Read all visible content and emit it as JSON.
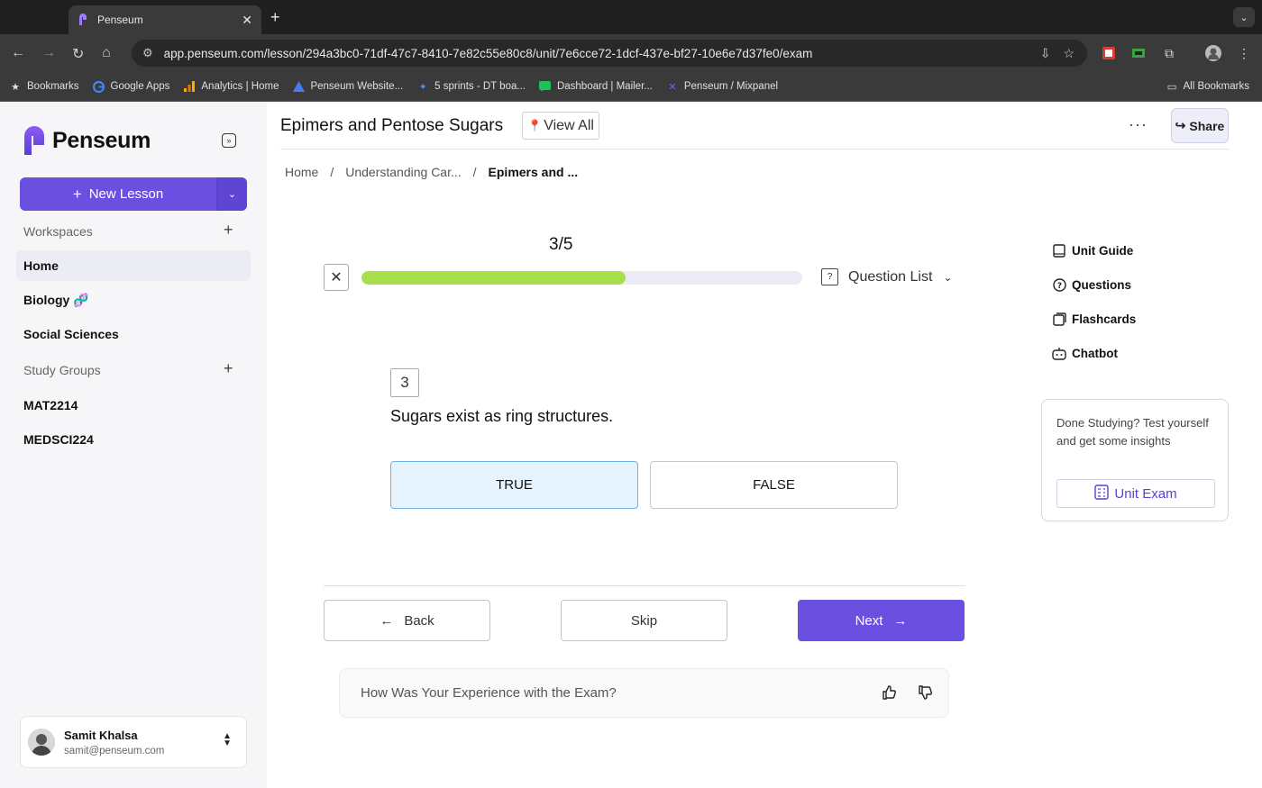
{
  "browser": {
    "tab_title": "Penseum",
    "url": "app.penseum.com/lesson/294a3bc0-71df-47c7-8410-7e82c55e80c8/unit/7e6cce72-1dcf-437e-bf27-10e6e7d37fe0/exam",
    "bookmarks": [
      {
        "label": "Bookmarks",
        "icon": "star-icon"
      },
      {
        "label": "Google Apps",
        "icon": "google-icon"
      },
      {
        "label": "Analytics | Home",
        "icon": "analytics-icon"
      },
      {
        "label": "Penseum Website...",
        "icon": "penseum-icon"
      },
      {
        "label": "5 sprints - DT boa...",
        "icon": "jira-icon"
      },
      {
        "label": "Dashboard | Mailer...",
        "icon": "mailer-icon"
      },
      {
        "label": "Penseum / Mixpanel",
        "icon": "mixpanel-icon"
      }
    ],
    "all_bookmarks": "All Bookmarks"
  },
  "sidebar": {
    "logo_text": "Penseum",
    "new_lesson": "New Lesson",
    "workspaces_label": "Workspaces",
    "workspaces": [
      {
        "label": "Home",
        "active": true
      },
      {
        "label": "Biology 🧬"
      },
      {
        "label": "Social Sciences"
      }
    ],
    "study_groups_label": "Study Groups",
    "study_groups": [
      {
        "label": "MAT2214"
      },
      {
        "label": "MEDSCI224"
      }
    ],
    "user": {
      "name": "Samit Khalsa",
      "email": "samit@penseum.com"
    }
  },
  "header": {
    "title": "Epimers and Pentose Sugars",
    "view_all": "View All",
    "share": "Share"
  },
  "breadcrumbs": [
    "Home",
    "/",
    "Understanding Car...",
    "/",
    "Epimers and ..."
  ],
  "exam": {
    "progress_label": "3/5",
    "progress_fraction": 0.6,
    "question_list": "Question List",
    "question_number": "3",
    "question_text": "Sugars exist as ring structures.",
    "answers": [
      {
        "label": "TRUE",
        "selected": true
      },
      {
        "label": "FALSE",
        "selected": false
      }
    ],
    "back": "Back",
    "skip": "Skip",
    "next": "Next",
    "feedback_prompt": "How Was Your Experience with the Exam?"
  },
  "right_panel": {
    "links": [
      {
        "label": "Unit Guide",
        "icon": "book-icon"
      },
      {
        "label": "Questions",
        "icon": "question-icon"
      },
      {
        "label": "Flashcards",
        "icon": "flashcards-icon"
      },
      {
        "label": "Chatbot",
        "icon": "bot-icon"
      }
    ],
    "done_text": "Done Studying? Test yourself and get some insights",
    "unit_exam": "Unit Exam"
  },
  "colors": {
    "accent": "#6a4fe0",
    "progress": "#a6e04a",
    "selected_bg": "#e6f3fd"
  }
}
